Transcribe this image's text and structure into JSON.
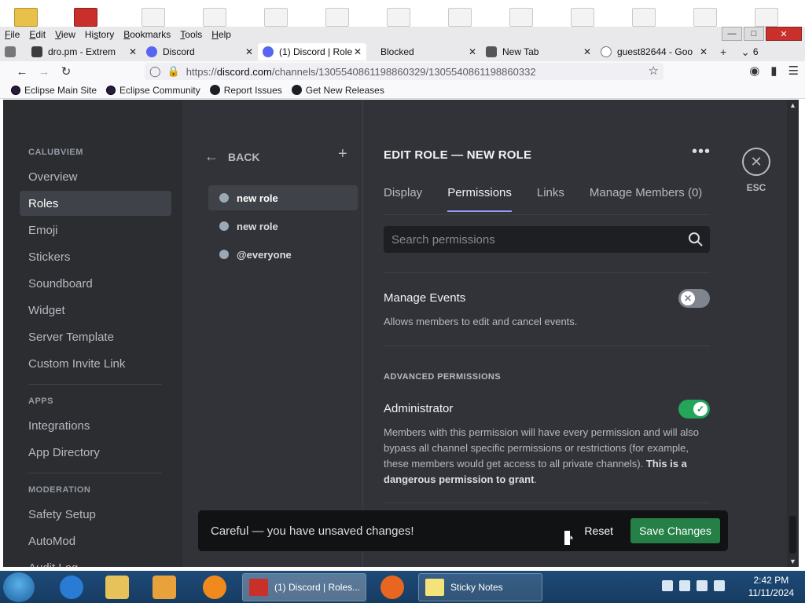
{
  "browser": {
    "menu": [
      {
        "pre": "",
        "u": "F",
        "post": "ile"
      },
      {
        "pre": "",
        "u": "E",
        "post": "dit"
      },
      {
        "pre": "",
        "u": "V",
        "post": "iew"
      },
      {
        "pre": "Hi",
        "u": "s",
        "post": "tory"
      },
      {
        "pre": "",
        "u": "B",
        "post": "ookmarks"
      },
      {
        "pre": "",
        "u": "T",
        "post": "ools"
      },
      {
        "pre": "",
        "u": "H",
        "post": "elp"
      }
    ],
    "tabs": [
      {
        "label": "dro.pm - Extrem"
      },
      {
        "label": "Discord"
      },
      {
        "label": "(1) Discord | Role"
      },
      {
        "label": "Blocked"
      },
      {
        "label": "New Tab"
      },
      {
        "label": "guest82644 - Goo"
      }
    ],
    "tab_count": "6",
    "url_prefix": "https://",
    "url_host": "discord.com",
    "url_path": "/channels/1305540861198860329/1305540861198860332",
    "bookmarks": [
      {
        "label": "Eclipse Main Site"
      },
      {
        "label": "Eclipse Community"
      },
      {
        "label": "Report Issues"
      },
      {
        "label": "Get New Releases"
      }
    ]
  },
  "sidebar": {
    "server_name": "CALUBVIEM",
    "items_main": [
      "Overview",
      "Roles",
      "Emoji",
      "Stickers",
      "Soundboard",
      "Widget",
      "Server Template",
      "Custom Invite Link"
    ],
    "apps_head": "APPS",
    "items_apps": [
      "Integrations",
      "App Directory"
    ],
    "moderation_head": "MODERATION",
    "items_mod": [
      "Safety Setup",
      "AutoMod",
      "Audit Log"
    ]
  },
  "roles": {
    "back_label": "BACK",
    "items": [
      "new role",
      "new role",
      "@everyone"
    ]
  },
  "main": {
    "title": "EDIT ROLE — NEW ROLE",
    "tabs": [
      "Display",
      "Permissions",
      "Links",
      "Manage Members (0)"
    ],
    "search_placeholder": "Search permissions",
    "manage_events": {
      "name": "Manage Events",
      "desc": "Allows members to edit and cancel events.",
      "enabled": false
    },
    "advanced_head": "ADVANCED PERMISSIONS",
    "administrator": {
      "name": "Administrator",
      "desc": "Members with this permission will have every permission and will also bypass all channel specific permissions or restrictions (for example, these members would get access to all private channels).",
      "desc_bold": "This is a dangerous permission to grant",
      "desc_end": ".",
      "enabled": true
    },
    "esc_label": "ESC"
  },
  "notice": {
    "text": "Careful — you have unsaved changes!",
    "reset": "Reset",
    "save": "Save Changes"
  },
  "taskbar": {
    "discord_task": "(1) Discord | Roles...",
    "sticky_task": "Sticky Notes",
    "time": "2:42 PM",
    "date": "11/11/2024"
  },
  "colors": {
    "accent_toggle_on": "#23a55a",
    "toggle_off": "#80848e",
    "save_button": "#248046",
    "tab_indicator": "#949cf7"
  }
}
